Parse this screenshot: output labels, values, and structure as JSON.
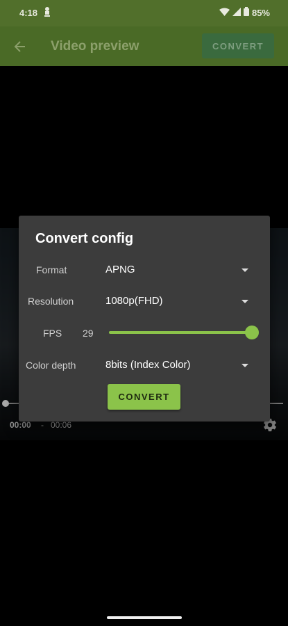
{
  "status_bar": {
    "time": "4:18",
    "battery": "85%",
    "icons": [
      "notification-icon",
      "wifi-icon",
      "signal-icon",
      "battery-icon"
    ]
  },
  "app_bar": {
    "title": "Video preview",
    "convert_label": "CONVERT",
    "back_icon": "arrow-back-icon"
  },
  "player": {
    "current_time": "00:00",
    "separator": "-",
    "total_time": "00:06",
    "progress": 0,
    "settings_icon": "gear-icon"
  },
  "dialog": {
    "title": "Convert config",
    "format": {
      "label": "Format",
      "value": "APNG"
    },
    "resolution": {
      "label": "Resolution",
      "value": "1080p(FHD)"
    },
    "fps": {
      "label": "FPS",
      "value": "29",
      "slider_fraction": 1.0
    },
    "color_depth": {
      "label": "Color depth",
      "value": "8bits (Index Color)"
    },
    "convert_label": "CONVERT"
  },
  "colors": {
    "accent": "#8bc34a",
    "app_bar": "#4a6a26",
    "dialog_bg": "#3c3c3c"
  }
}
